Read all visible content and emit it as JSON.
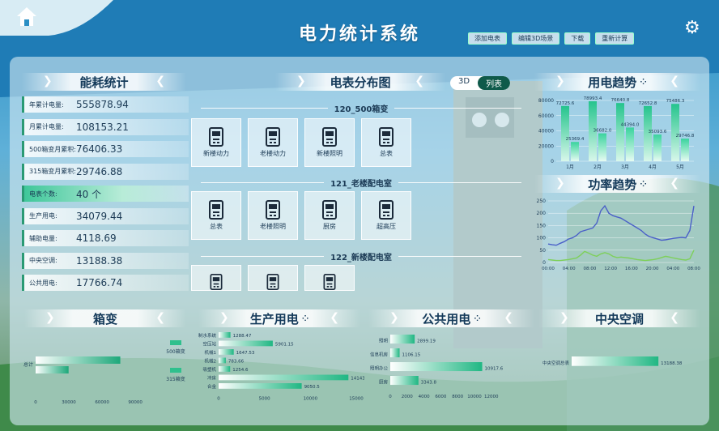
{
  "header": {
    "title": "电力统计系统",
    "buttons": [
      "添加电表",
      "编辑3D场景",
      "下载",
      "重新计算"
    ]
  },
  "energy_panel": {
    "title": "能耗统计",
    "stats": [
      {
        "label": "年累计电量:",
        "value": "555878.94"
      },
      {
        "label": "月累计电量:",
        "value": "108153.21"
      },
      {
        "label": "500箱变月累积:",
        "value": "76406.33"
      },
      {
        "label": "315箱变月累积:",
        "value": "29746.88"
      },
      {
        "label": "电表个数:",
        "value": "40 个"
      },
      {
        "label": "生产用电:",
        "value": "34079.44"
      },
      {
        "label": "辅助电量:",
        "value": "4118.69"
      },
      {
        "label": "中央空调:",
        "value": "13188.38"
      },
      {
        "label": "公共用电:",
        "value": "17766.74"
      }
    ]
  },
  "meter_panel": {
    "title": "电表分布图",
    "tabs": [
      "3D",
      "列表"
    ],
    "sections": [
      {
        "name": "120_500箱变",
        "meters": [
          "新楼动力",
          "老楼动力",
          "新楼照明",
          "总表"
        ]
      },
      {
        "name": "121_老楼配电室",
        "meters": [
          "总表",
          "老楼照明",
          "厨房",
          "超高压"
        ]
      },
      {
        "name": "122_新楼配电室",
        "meters": [
          "",
          "",
          ""
        ]
      }
    ]
  },
  "usage_panel": {
    "title": "用电趋势"
  },
  "power_panel": {
    "title": "功率趋势"
  },
  "box_panel": {
    "title": "箱变"
  },
  "prod_panel": {
    "title": "生产用电"
  },
  "public_panel": {
    "title": "公共用电"
  },
  "ac_panel": {
    "title": "中央空调"
  },
  "chart_data": [
    {
      "type": "bar",
      "title": "用电趋势",
      "categories": [
        "1月",
        "2月",
        "3月",
        "4月",
        "5月"
      ],
      "series": [
        {
          "values": [
            72725.6,
            78993.4,
            76640.8,
            72652.8,
            75486.3
          ]
        },
        {
          "values": [
            25369.4,
            36682.0,
            44394.0,
            35093.6,
            29746.8
          ]
        }
      ],
      "ylim": [
        0,
        80000
      ],
      "yticks": [
        0,
        20000,
        40000,
        60000,
        80000
      ]
    },
    {
      "type": "line",
      "title": "功率趋势",
      "xticks": [
        "00:00",
        "04:00",
        "08:00",
        "12:00",
        "16:00",
        "20:00",
        "04:00",
        "08:00"
      ],
      "yticks": [
        0,
        50,
        100,
        150,
        200,
        250
      ],
      "ylim": [
        0,
        250
      ],
      "series": [
        {
          "color": "#4a5fc8",
          "values": [
            75,
            72,
            70,
            78,
            85,
            95,
            100,
            110,
            125,
            130,
            135,
            140,
            160,
            210,
            230,
            200,
            190,
            185,
            180,
            170,
            160,
            150,
            140,
            130,
            115,
            105,
            100,
            95,
            90,
            92,
            95,
            98,
            100,
            102,
            100,
            130,
            230
          ]
        },
        {
          "color": "#7ed05a",
          "values": [
            12,
            10,
            8,
            8,
            10,
            12,
            15,
            18,
            30,
            45,
            38,
            30,
            25,
            35,
            40,
            35,
            25,
            20,
            22,
            20,
            18,
            15,
            12,
            10,
            8,
            10,
            12,
            15,
            20,
            25,
            22,
            18,
            15,
            12,
            10,
            15,
            50
          ]
        }
      ]
    },
    {
      "type": "bar",
      "title": "箱变",
      "categories": [
        "总计"
      ],
      "series": [
        {
          "name": "500箱变",
          "values": [
            76406.33
          ]
        },
        {
          "name": "315箱变",
          "values": [
            29746.88
          ]
        }
      ],
      "xticks": [
        0,
        30000,
        60000,
        90000
      ]
    },
    {
      "type": "bar",
      "title": "生产用电",
      "categories": [
        "制水系统",
        "空压站",
        "机械1",
        "机械2",
        "吸塑机",
        "冲床",
        "合金"
      ],
      "values": [
        1288.47,
        5901.15,
        1647.53,
        783.66,
        1254.6,
        14143,
        9050.5
      ],
      "xticks": [
        0,
        5000,
        10000,
        15000
      ]
    },
    {
      "type": "bar",
      "title": "公共用电",
      "categories": [
        "照明",
        "信息机房",
        "照明办公",
        "厨房"
      ],
      "values": [
        2899.19,
        1106.15,
        10917.6,
        3343.8
      ],
      "xticks": [
        0,
        2000,
        4000,
        6000,
        8000,
        10000,
        12000
      ]
    },
    {
      "type": "bar",
      "title": "中央空调",
      "categories": [
        "中央空调总表"
      ],
      "values": [
        13188.38
      ]
    }
  ]
}
